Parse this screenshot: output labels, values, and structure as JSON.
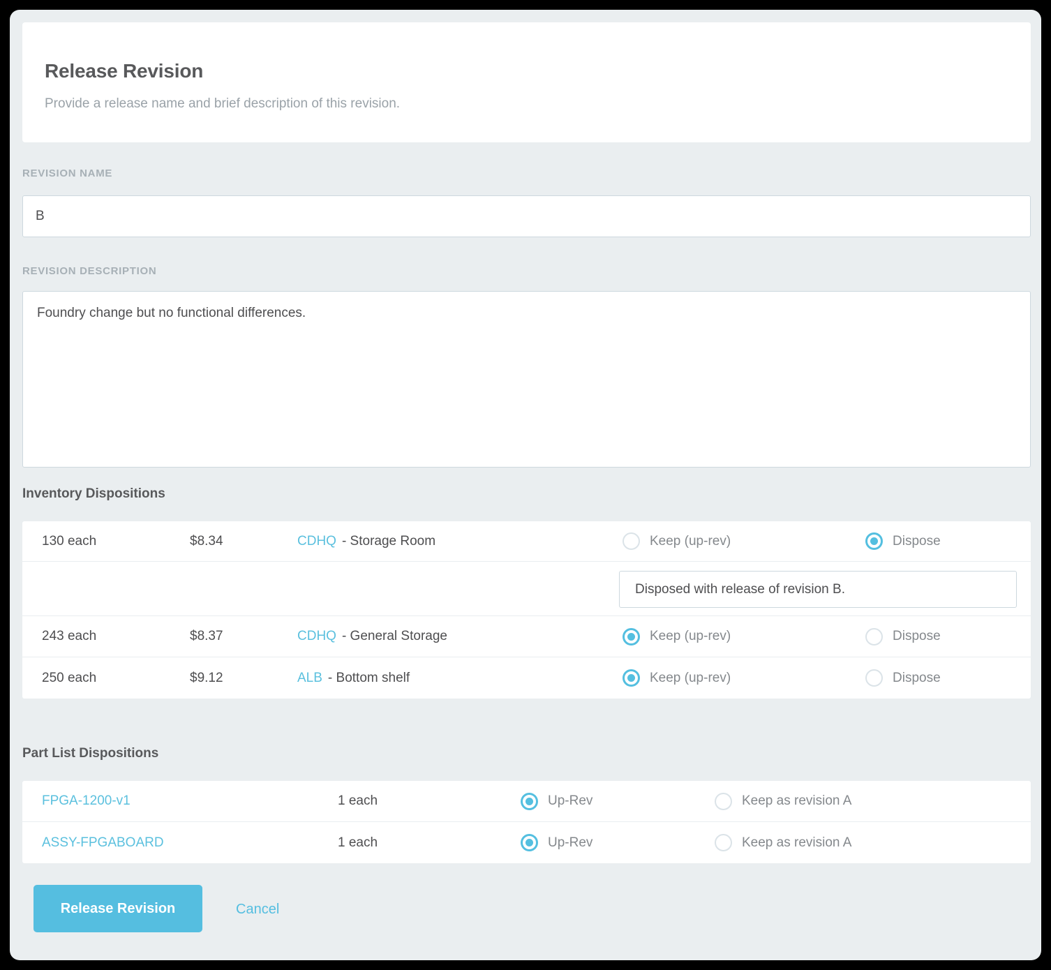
{
  "header": {
    "title": "Release Revision",
    "subtitle": "Provide a release name and brief description of this revision."
  },
  "form": {
    "revision_name_label": "REVISION NAME",
    "revision_name_value": "B",
    "revision_name_placeholder": "",
    "revision_description_label": "REVISION DESCRIPTION",
    "revision_description_value": "Foundry change but no functional differences.",
    "revision_description_placeholder": ""
  },
  "inventory": {
    "title": "Inventory Dispositions",
    "rows": [
      {
        "qty": "130 each",
        "price": "$8.34",
        "location_code": "CDHQ",
        "location_name": "- Storage Room",
        "keep_label": "Keep (up-rev)",
        "keep_selected": false,
        "dispose_label": "Dispose",
        "dispose_selected": true,
        "note_value": "Disposed with release of revision B.",
        "note_placeholder": ""
      },
      {
        "qty": "243 each",
        "price": "$8.37",
        "location_code": "CDHQ",
        "location_name": "- General Storage",
        "keep_label": "Keep (up-rev)",
        "keep_selected": true,
        "dispose_label": "Dispose",
        "dispose_selected": false
      },
      {
        "qty": "250 each",
        "price": "$9.12",
        "location_code": "ALB",
        "location_name": "- Bottom shelf",
        "keep_label": "Keep (up-rev)",
        "keep_selected": true,
        "dispose_label": "Dispose",
        "dispose_selected": false
      }
    ]
  },
  "partlist": {
    "title": "Part List Dispositions",
    "rows": [
      {
        "part": "FPGA-1200-v1",
        "qty": "1 each",
        "uprev_label": "Up-Rev",
        "uprev_selected": true,
        "keep_label": "Keep as revision A",
        "keep_selected": false
      },
      {
        "part": "ASSY-FPGABOARD",
        "qty": "1 each",
        "uprev_label": "Up-Rev",
        "uprev_selected": true,
        "keep_label": "Keep as revision A",
        "keep_selected": false
      }
    ]
  },
  "footer": {
    "submit_label": "Release Revision",
    "cancel_label": "Cancel"
  },
  "colors": {
    "accent": "#55bee0",
    "link": "#5bc0de",
    "page_bg": "#eaeef0",
    "card_bg": "#ffffff",
    "border": "#cdd8de",
    "heading": "#58595b",
    "muted": "#9aa2a8"
  }
}
